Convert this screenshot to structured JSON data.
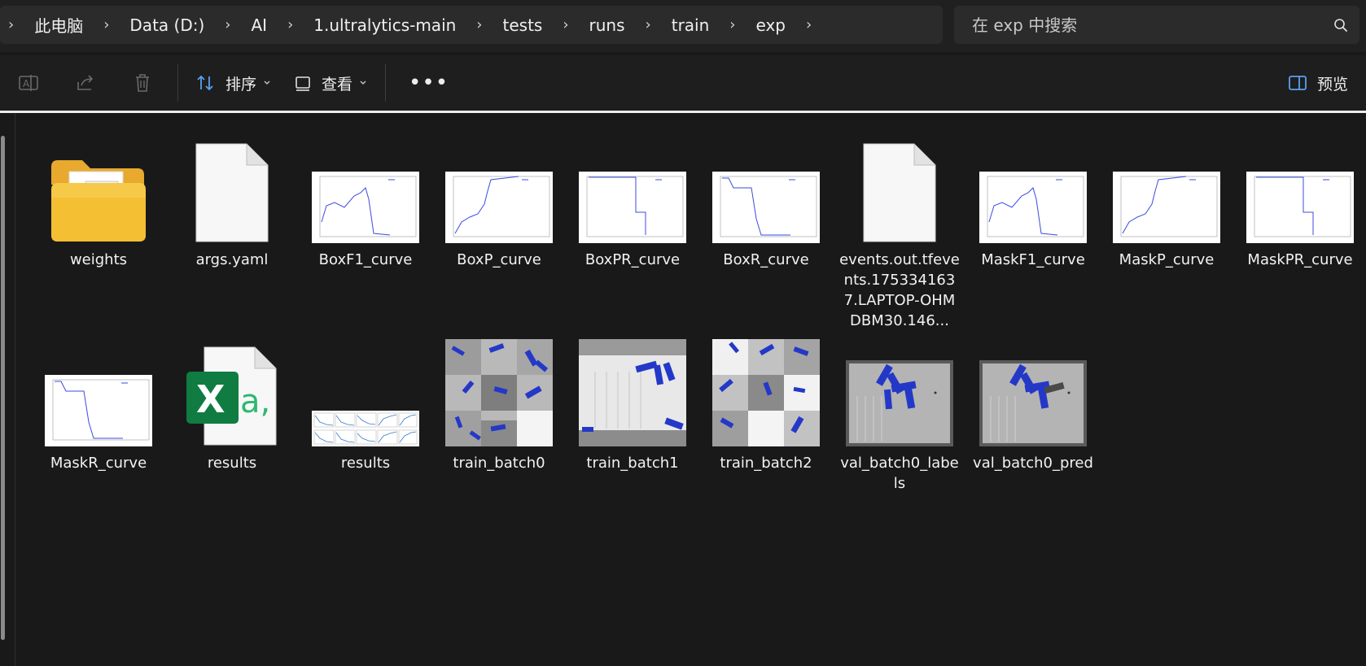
{
  "breadcrumb": {
    "segments": [
      "此电脑",
      "Data (D:)",
      "AI",
      "1.ultralytics-main",
      "tests",
      "runs",
      "train",
      "exp"
    ]
  },
  "search": {
    "placeholder": "在 exp 中搜索"
  },
  "toolbar": {
    "sort_label": "排序",
    "view_label": "查看",
    "more_label": "•••",
    "preview_label": "预览"
  },
  "files": [
    {
      "name": "weights",
      "kind": "folder"
    },
    {
      "name": "args.yaml",
      "kind": "doc"
    },
    {
      "name": "BoxF1_curve",
      "kind": "curve"
    },
    {
      "name": "BoxP_curve",
      "kind": "curve"
    },
    {
      "name": "BoxPR_curve",
      "kind": "curve"
    },
    {
      "name": "BoxR_curve",
      "kind": "curve"
    },
    {
      "name": "events.out.tfevents.1753341637.LAPTOP-OHMDBM30.146...",
      "kind": "doc"
    },
    {
      "name": "MaskF1_curve",
      "kind": "curve"
    },
    {
      "name": "MaskP_curve",
      "kind": "curve"
    },
    {
      "name": "MaskPR_curve",
      "kind": "curve"
    },
    {
      "name": "MaskR_curve",
      "kind": "curve"
    },
    {
      "name": "results",
      "kind": "excel"
    },
    {
      "name": "results",
      "kind": "results-plot"
    },
    {
      "name": "train_batch0",
      "kind": "mosaic"
    },
    {
      "name": "train_batch1",
      "kind": "mosaic"
    },
    {
      "name": "train_batch2",
      "kind": "mosaic"
    },
    {
      "name": "val_batch0_labels",
      "kind": "val"
    },
    {
      "name": "val_batch0_pred",
      "kind": "val"
    }
  ],
  "colors": {
    "accent_blue": "#2b46d6",
    "excel_green": "#107c41",
    "folder_yellow": "#f5c84c"
  }
}
